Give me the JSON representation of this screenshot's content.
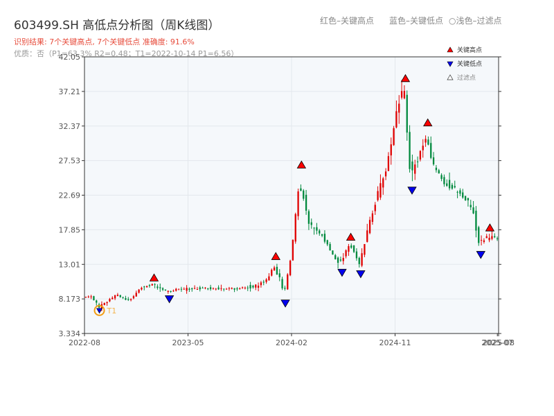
{
  "header": {
    "title": "603499.SH 高低点分析图（周K线图）",
    "note_high": "红色–关键高点",
    "note_low": "蓝色–关键低点",
    "note_filter": "○浅色–过滤点",
    "result_line": "识别结果: 7个关键高点, 7个关键低点  准确度: 91.6%",
    "detail_line": "优质：否（P1=63.3%  R2=0.48；T1=2022-10-14 P1=6.56）"
  },
  "colors": {
    "up": "#e00000",
    "down": "#00893d",
    "high_marker": "#ff0000",
    "low_marker": "#0000ee",
    "t1_marker": "#f39c12",
    "plot_bg": "#f5f8fb"
  },
  "chart_data": {
    "type": "candlestick",
    "ylim": [
      3.334,
      42.05
    ],
    "y_ticks": [
      "3.334",
      "8.173",
      "13.01",
      "17.85",
      "22.69",
      "27.53",
      "32.37",
      "37.21",
      "42.05"
    ],
    "x_ticks": [
      "2022-08",
      "2023-05",
      "2024-02",
      "2024-11",
      "2025-07",
      "2025-08"
    ],
    "legend": [
      {
        "label": "关键高点",
        "marker": "triangle-up",
        "color": "#ff0000"
      },
      {
        "label": "关键低点",
        "marker": "triangle-down",
        "color": "#0000ee"
      },
      {
        "label": "过滤点",
        "marker": "triangle-up-hollow",
        "color": "#999999"
      }
    ],
    "t1_label": "T1",
    "key_highs": [
      {
        "x": 0.168,
        "price": 10.5
      },
      {
        "x": 0.462,
        "price": 13.5
      },
      {
        "x": 0.524,
        "price": 26.3
      },
      {
        "x": 0.643,
        "price": 16.2
      },
      {
        "x": 0.775,
        "price": 38.4
      },
      {
        "x": 0.829,
        "price": 32.2
      },
      {
        "x": 0.979,
        "price": 17.5
      }
    ],
    "key_lows": [
      {
        "x": 0.205,
        "price": 8.8
      },
      {
        "x": 0.485,
        "price": 8.2
      },
      {
        "x": 0.622,
        "price": 12.5
      },
      {
        "x": 0.667,
        "price": 12.3
      },
      {
        "x": 0.791,
        "price": 24.0
      },
      {
        "x": 0.957,
        "price": 15.0
      }
    ],
    "t1_point": {
      "x": 0.036,
      "price": 6.56
    },
    "price_path": [
      [
        0.0,
        8.3
      ],
      [
        0.02,
        8.6
      ],
      [
        0.034,
        7.3
      ],
      [
        0.036,
        6.8
      ],
      [
        0.05,
        7.5
      ],
      [
        0.08,
        8.8
      ],
      [
        0.11,
        7.9
      ],
      [
        0.14,
        9.8
      ],
      [
        0.165,
        10.2
      ],
      [
        0.2,
        9.2
      ],
      [
        0.23,
        9.5
      ],
      [
        0.3,
        9.7
      ],
      [
        0.36,
        9.6
      ],
      [
        0.42,
        10.0
      ],
      [
        0.445,
        11.0
      ],
      [
        0.46,
        12.8
      ],
      [
        0.475,
        11.0
      ],
      [
        0.485,
        9.0
      ],
      [
        0.5,
        13.5
      ],
      [
        0.51,
        18.0
      ],
      [
        0.52,
        24.0
      ],
      [
        0.53,
        23.0
      ],
      [
        0.545,
        18.5
      ],
      [
        0.56,
        18.0
      ],
      [
        0.58,
        17.0
      ],
      [
        0.6,
        14.5
      ],
      [
        0.62,
        13.2
      ],
      [
        0.643,
        15.8
      ],
      [
        0.655,
        14.8
      ],
      [
        0.667,
        13.0
      ],
      [
        0.69,
        18.5
      ],
      [
        0.71,
        22.5
      ],
      [
        0.73,
        26.0
      ],
      [
        0.745,
        30.0
      ],
      [
        0.76,
        35.0
      ],
      [
        0.775,
        37.5
      ],
      [
        0.79,
        25.5
      ],
      [
        0.81,
        28.0
      ],
      [
        0.829,
        31.0
      ],
      [
        0.845,
        27.0
      ],
      [
        0.87,
        24.5
      ],
      [
        0.9,
        23.5
      ],
      [
        0.94,
        21.0
      ],
      [
        0.955,
        16.2
      ],
      [
        0.979,
        16.8
      ],
      [
        1.0,
        16.5
      ]
    ]
  }
}
